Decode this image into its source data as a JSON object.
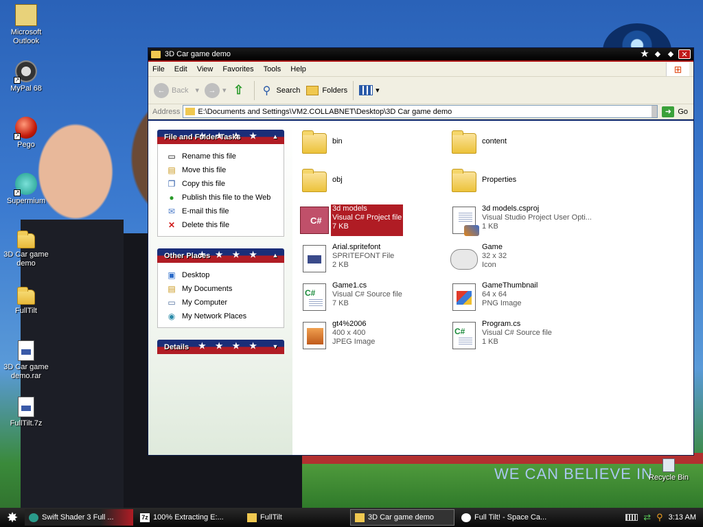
{
  "desktop": {
    "icons": [
      {
        "label": "Microsoft Outlook",
        "icon": "outlook-icon"
      },
      {
        "label": "MyPal 68",
        "icon": "raccoon-icon"
      },
      {
        "label": "Pego",
        "icon": "pego-icon"
      },
      {
        "label": "Supermium",
        "icon": "supermium-icon"
      },
      {
        "label": "3D Car game demo",
        "icon": "folder-icon"
      },
      {
        "label": "FullTilt",
        "icon": "folder-icon"
      },
      {
        "label": "3D Car game demo.rar",
        "icon": "archive-icon"
      },
      {
        "label": "FullTilt.7z",
        "icon": "archive-icon"
      }
    ],
    "recycle_bin": "Recycle Bin",
    "wallpaper_text": "WE CAN BELIEVE IN"
  },
  "window": {
    "title": "3D Car game demo",
    "menu": [
      "File",
      "Edit",
      "View",
      "Favorites",
      "Tools",
      "Help"
    ],
    "toolbar": {
      "back": "Back",
      "search": "Search",
      "folders": "Folders"
    },
    "address": {
      "label": "Address",
      "value": "E:\\Documents and Settings\\VM2.COLLABNET\\Desktop\\3D Car game demo",
      "go": "Go"
    },
    "tasks": {
      "file_folder": {
        "title": "File and Folder Tasks",
        "items": [
          "Rename this file",
          "Move this file",
          "Copy this file",
          "Publish this file to the Web",
          "E-mail this file",
          "Delete this file"
        ]
      },
      "other_places": {
        "title": "Other Places",
        "items": [
          "Desktop",
          "My Documents",
          "My Computer",
          "My Network Places"
        ]
      },
      "details": {
        "title": "Details"
      }
    },
    "files": [
      {
        "name": "bin",
        "type": "folder"
      },
      {
        "name": "content",
        "type": "folder"
      },
      {
        "name": "obj",
        "type": "folder"
      },
      {
        "name": "Properties",
        "type": "folder"
      },
      {
        "name": "3d models",
        "line2": "Visual C# Project file",
        "line3": "7 KB",
        "type": "csproj",
        "selected": true
      },
      {
        "name": "3d models.csproj",
        "line2": "Visual Studio Project User Opti...",
        "line3": "1 KB",
        "type": "vsuser"
      },
      {
        "name": "Arial.spritefont",
        "line2": "SPRITEFONT File",
        "line3": "2 KB",
        "type": "doc"
      },
      {
        "name": "Game",
        "line2": "32 x 32",
        "line3": "Icon",
        "type": "gamepad"
      },
      {
        "name": "Game1.cs",
        "line2": "Visual C# Source file",
        "line3": "7 KB",
        "type": "cs"
      },
      {
        "name": "GameThumbnail",
        "line2": "64 x 64",
        "line3": "PNG Image",
        "type": "png"
      },
      {
        "name": "gt4%2006",
        "line2": "400 x 400",
        "line3": "JPEG Image",
        "type": "jpg"
      },
      {
        "name": "Program.cs",
        "line2": "Visual C# Source file",
        "line3": "1 KB",
        "type": "cs"
      }
    ]
  },
  "taskbar": {
    "tasks": [
      "Swift Shader 3 Full ...",
      "100% Extracting E:...",
      "FullTilt",
      "3D Car game demo",
      "Full Tilt! - Space Ca..."
    ],
    "active_index": 3,
    "clock": "3:13 AM"
  },
  "colors": {
    "accent_red": "#b01c24",
    "accent_navy": "#1a2e78"
  }
}
